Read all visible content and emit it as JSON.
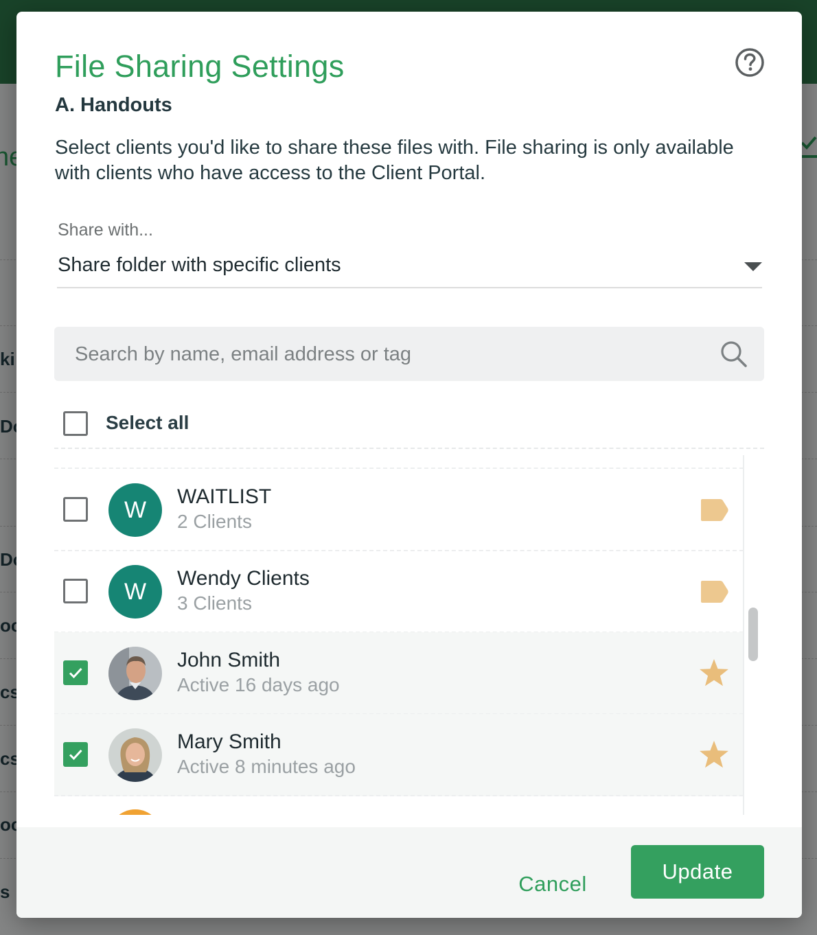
{
  "background": {
    "fragments": [
      "ne",
      "ki",
      "Do",
      "Do",
      "oc",
      "cs",
      "cs",
      "oc",
      "s"
    ]
  },
  "dialog": {
    "title": "File Sharing Settings",
    "subtitle": "A. Handouts",
    "description": "Select clients you'd like to share these files with. File sharing is only available with clients who have access to the Client Portal.",
    "share_with": {
      "label": "Share with...",
      "selected": "Share folder with specific clients"
    },
    "search": {
      "placeholder": "Search by name, email address or tag",
      "value": ""
    },
    "select_all": {
      "label": "Select all",
      "checked": false
    },
    "items": [
      {
        "name": "WAITLIST",
        "subtext": "2 Clients",
        "avatar_letter": "W",
        "type": "tag",
        "checked": false,
        "icon": "tag-icon"
      },
      {
        "name": "Wendy Clients",
        "subtext": "3 Clients",
        "avatar_letter": "W",
        "type": "tag",
        "checked": false,
        "icon": "tag-icon"
      },
      {
        "name": "John Smith",
        "subtext": "Active 16 days ago",
        "avatar_letter": "",
        "type": "client",
        "checked": true,
        "icon": "star-icon"
      },
      {
        "name": "Mary Smith",
        "subtext": "Active 8 minutes ago",
        "avatar_letter": "",
        "type": "client",
        "checked": true,
        "icon": "star-icon"
      }
    ],
    "buttons": {
      "cancel": "Cancel",
      "update": "Update"
    }
  },
  "colors": {
    "brand_green": "#2f9e5b",
    "checkbox_green": "#34a05f",
    "avatar_teal": "#168574",
    "tag_icon": "#edc88f",
    "star_icon": "#e9bd7b",
    "peek_avatar": "#f0a232"
  }
}
